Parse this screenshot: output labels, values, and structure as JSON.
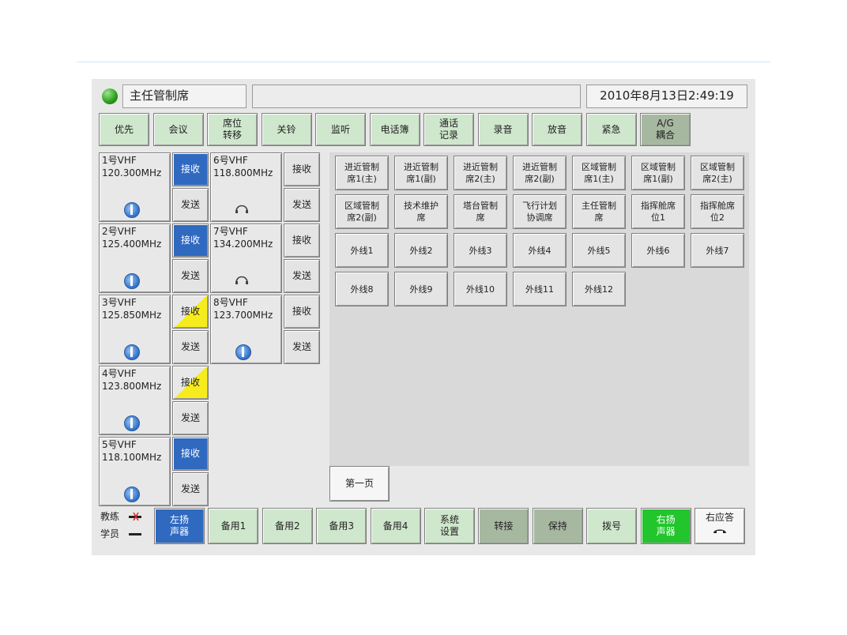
{
  "header": {
    "station_title": "主任管制席",
    "datetime": "2010年8月13日2:49:19"
  },
  "function_buttons": [
    {
      "label": "优先",
      "style": "green"
    },
    {
      "label": "会议",
      "style": "green"
    },
    {
      "label": "席位\n转移",
      "style": "green"
    },
    {
      "label": "关铃",
      "style": "green"
    },
    {
      "label": "监听",
      "style": "green"
    },
    {
      "label": "电话簿",
      "style": "green"
    },
    {
      "label": "通话\n记录",
      "style": "green"
    },
    {
      "label": "录音",
      "style": "green"
    },
    {
      "label": "放音",
      "style": "green"
    },
    {
      "label": "紧急",
      "style": "green"
    },
    {
      "label": "A/G\n耦合",
      "style": "dgreen"
    }
  ],
  "radios_left": [
    {
      "name": "1号VHF",
      "freq": "120.300MHz",
      "receive_label": "接收",
      "send_label": "发送",
      "receive_state": "blue",
      "icon": "speaker-icon"
    },
    {
      "name": "2号VHF",
      "freq": "125.400MHz",
      "receive_label": "接收",
      "send_label": "发送",
      "receive_state": "blue",
      "icon": "speaker-icon"
    },
    {
      "name": "3号VHF",
      "freq": "125.850MHz",
      "receive_label": "接收",
      "send_label": "发送",
      "receive_state": "yellow",
      "icon": "speaker-icon"
    },
    {
      "name": "4号VHF",
      "freq": "123.800MHz",
      "receive_label": "接收",
      "send_label": "发送",
      "receive_state": "yellow",
      "icon": "speaker-icon"
    },
    {
      "name": "5号VHF",
      "freq": "118.100MHz",
      "receive_label": "接收",
      "send_label": "发送",
      "receive_state": "blue",
      "icon": "speaker-icon"
    }
  ],
  "radios_right": [
    {
      "name": "6号VHF",
      "freq": "118.800MHz",
      "receive_label": "接收",
      "send_label": "发送",
      "receive_state": "gray",
      "icon": "headset-icon"
    },
    {
      "name": "7号VHF",
      "freq": "134.200MHz",
      "receive_label": "接收",
      "send_label": "发送",
      "receive_state": "gray",
      "icon": "headset-icon"
    },
    {
      "name": "8号VHF",
      "freq": "123.700MHz",
      "receive_label": "接收",
      "send_label": "发送",
      "receive_state": "gray",
      "icon": "speaker-icon"
    }
  ],
  "line_buttons": [
    "进近管制\n席1(主)",
    "进近管制\n席1(副)",
    "进近管制\n席2(主)",
    "进近管制\n席2(副)",
    "区域管制\n席1(主)",
    "区域管制\n席1(副)",
    "区域管制\n席2(主)",
    "区域管制\n席2(副)",
    "技术维护\n席",
    "塔台管制\n席",
    "飞行计划\n协调席",
    "主任管制\n席",
    "指挥舱席\n位1",
    "指挥舱席\n位2",
    "外线1",
    "外线2",
    "外线3",
    "外线4",
    "外线5",
    "外线6",
    "外线7",
    "外线8",
    "外线9",
    "外线10",
    "外线11",
    "外线12"
  ],
  "page_tab": "第一页",
  "legend": {
    "instructor": "教练",
    "student": "学员"
  },
  "bottom_buttons": [
    {
      "label": "左扬\n声器",
      "style": "blue"
    },
    {
      "label": "备用1",
      "style": "green"
    },
    {
      "label": "备用2",
      "style": "green"
    },
    {
      "label": "备用3",
      "style": "green"
    },
    {
      "label": "备用4",
      "style": "green"
    },
    {
      "label": "系统\n设置",
      "style": "green"
    },
    {
      "label": "转接",
      "style": "dgreen"
    },
    {
      "label": "保持",
      "style": "dgreen"
    },
    {
      "label": "拨号",
      "style": "green"
    },
    {
      "label": "右扬\n声器",
      "style": "bright"
    },
    {
      "label": "右应答",
      "style": "white"
    }
  ]
}
